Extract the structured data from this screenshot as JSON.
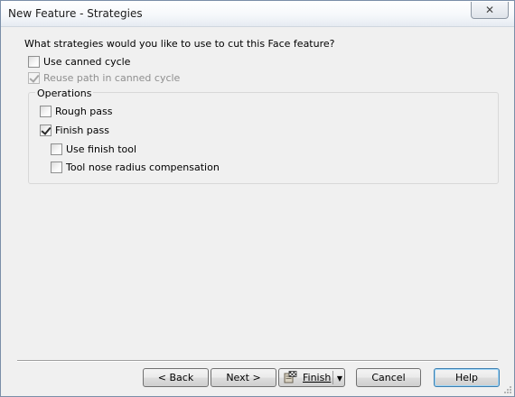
{
  "window": {
    "title": "New Feature - Strategies",
    "close_glyph": "✕"
  },
  "prompt": "What strategies would you like to use to cut this Face feature?",
  "options": {
    "use_canned_cycle": {
      "label": "Use canned cycle",
      "checked": false,
      "enabled": true
    },
    "reuse_path": {
      "label": "Reuse path in canned cycle",
      "checked": true,
      "enabled": false
    }
  },
  "operations": {
    "group_label": "Operations",
    "rough_pass": {
      "label": "Rough pass",
      "checked": false
    },
    "finish_pass": {
      "label": "Finish pass",
      "checked": true
    },
    "use_finish_tool": {
      "label": "Use finish tool",
      "checked": false
    },
    "tool_nose_radius": {
      "label": "Tool nose radius compensation",
      "checked": false
    }
  },
  "buttons": {
    "back": "< Back",
    "next": "Next >",
    "finish": "Finish",
    "finish_dropdown_glyph": "▼",
    "cancel": "Cancel",
    "help": "Help"
  },
  "icons": {
    "finish": "finish-flag-icon",
    "close": "close-icon",
    "checkmark": "checkmark-icon"
  }
}
